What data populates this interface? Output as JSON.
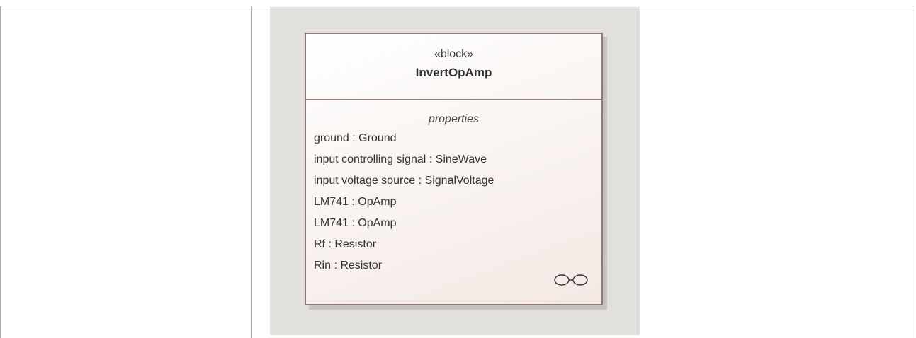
{
  "block": {
    "stereotype": "«block»",
    "name": "InvertOpAmp",
    "compartment_title": "properties",
    "properties": [
      "ground : Ground",
      "input controlling signal : SineWave",
      "input voltage source : SignalVoltage",
      "LM741 : OpAmp",
      "LM741 : OpAmp",
      "Rf : Resistor",
      "Rin : Resistor"
    ],
    "composite_icon": "composite-diagram-icon"
  },
  "colors": {
    "canvas": "#e2e0dd",
    "block_border": "#8e7a78",
    "block_fill_end": "#f4e9e4"
  }
}
